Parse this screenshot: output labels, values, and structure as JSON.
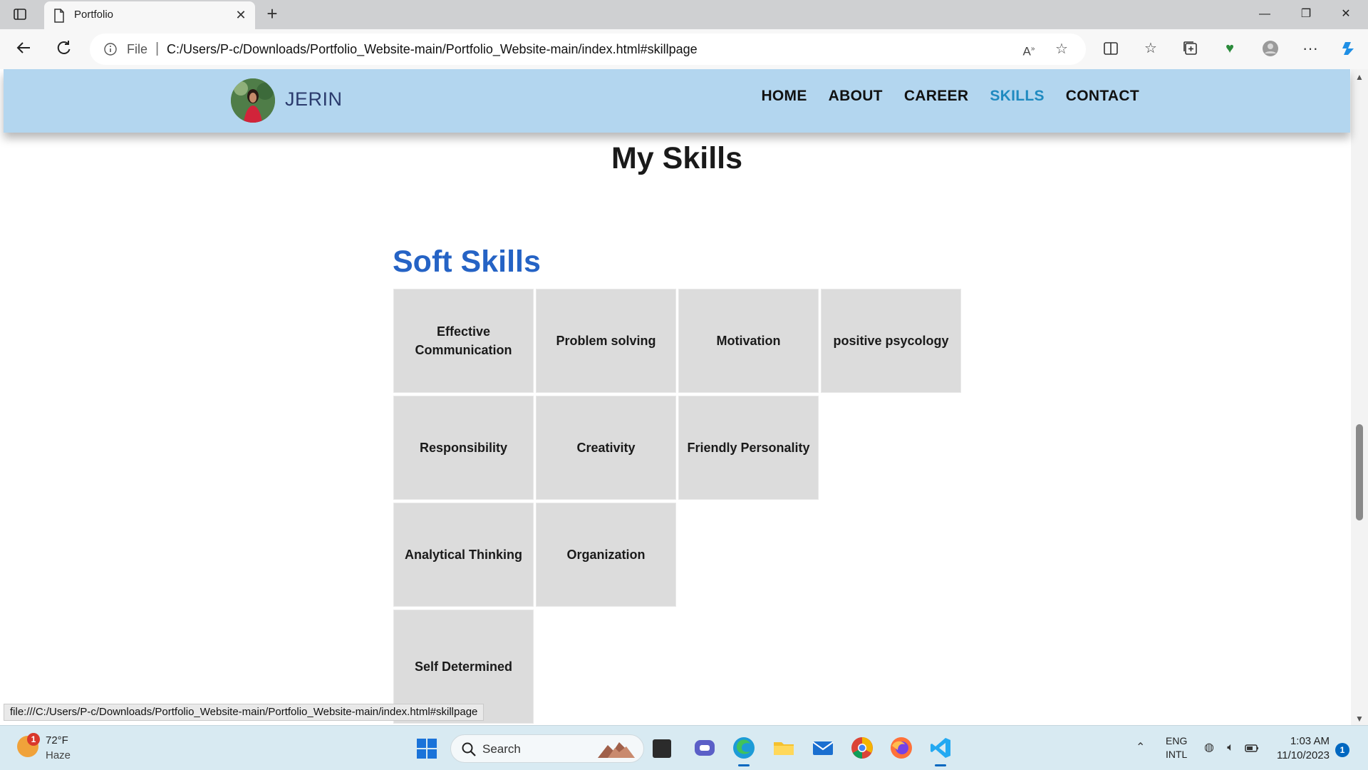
{
  "browser": {
    "tab_title": "Portfolio",
    "file_label": "File",
    "url": "C:/Users/P-c/Downloads/Portfolio_Website-main/Portfolio_Website-main/index.html#skillpage",
    "status_url": "file:///C:/Users/P-c/Downloads/Portfolio_Website-main/Portfolio_Website-main/index.html#skillpage"
  },
  "site": {
    "brand_name": "JERIN",
    "nav": [
      {
        "label": "HOME",
        "active": false
      },
      {
        "label": "ABOUT",
        "active": false
      },
      {
        "label": "CAREER",
        "active": false
      },
      {
        "label": "SKILLS",
        "active": true
      },
      {
        "label": "CONTACT",
        "active": false
      }
    ],
    "page_title": "My Skills",
    "section_title": "Soft Skills",
    "skills": [
      "Effective Communication",
      "Problem solving",
      "Motivation",
      "positive psycology",
      "Responsibility",
      "Creativity",
      "Friendly Personality",
      "Analytical Thinking",
      "Organization",
      "Self Determined"
    ],
    "colors": {
      "header_bg": "#b3d6ef",
      "brand_text": "#2b3b6d",
      "active_nav": "#1f8ac0",
      "section_title": "#2563c5",
      "card_bg": "#dcdcdc"
    }
  },
  "taskbar": {
    "weather_alert": "1",
    "temperature": "72°F",
    "condition": "Haze",
    "search_placeholder": "Search",
    "lang_line1": "ENG",
    "lang_line2": "INTL",
    "time": "1:03 AM",
    "date": "11/10/2023",
    "notification_count": "1"
  }
}
